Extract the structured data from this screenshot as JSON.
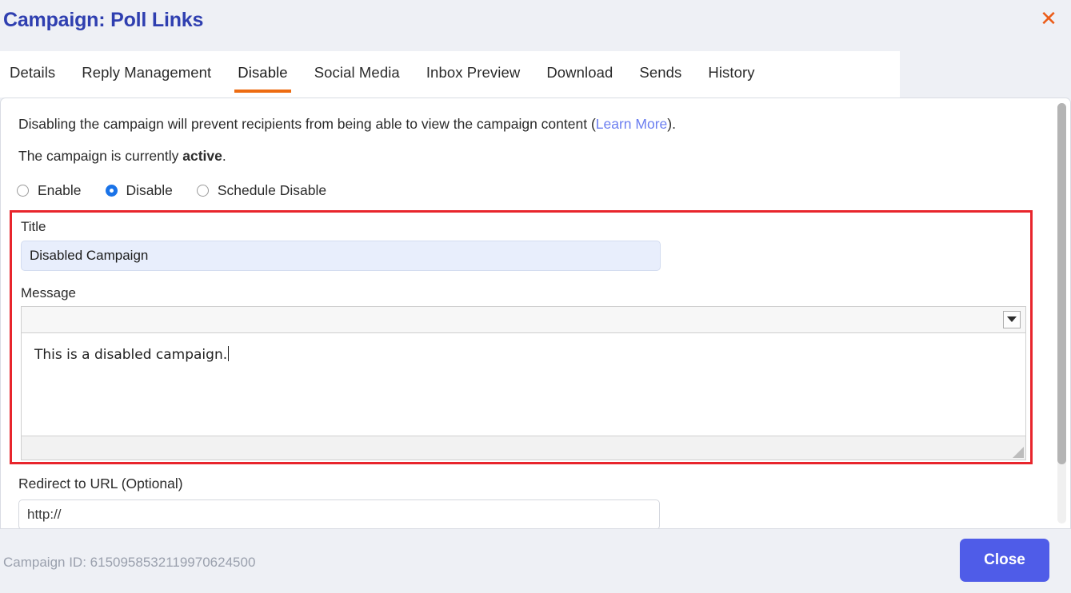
{
  "header": {
    "title": "Campaign: Poll Links",
    "close_icon": "close-x-icon"
  },
  "tabs": [
    {
      "label": "Details",
      "active": false
    },
    {
      "label": "Reply Management",
      "active": false
    },
    {
      "label": "Disable",
      "active": true
    },
    {
      "label": "Social Media",
      "active": false
    },
    {
      "label": "Inbox Preview",
      "active": false
    },
    {
      "label": "Download",
      "active": false
    },
    {
      "label": "Sends",
      "active": false
    },
    {
      "label": "History",
      "active": false
    }
  ],
  "content": {
    "intro_prefix": "Disabling the campaign will prevent recipients from being able to view the campaign content (",
    "intro_link": "Learn More",
    "intro_suffix": ").",
    "status_prefix": "The campaign is currently ",
    "status_value": "active",
    "status_suffix": ".",
    "radios": [
      {
        "label": "Enable",
        "checked": false
      },
      {
        "label": "Disable",
        "checked": true
      },
      {
        "label": "Schedule Disable",
        "checked": false
      }
    ],
    "title_field": {
      "label": "Title",
      "value": "Disabled Campaign",
      "placeholder": ""
    },
    "message_field": {
      "label": "Message",
      "value": "This is a disabled campaign.",
      "toolbar_dropdown_icon": "chevron-down-icon",
      "resize_grip_icon": "resize-grip-icon"
    },
    "redirect_field": {
      "label": "Redirect to URL (Optional)",
      "value": "http://",
      "placeholder": "http://"
    }
  },
  "footer": {
    "campaign_id": "Campaign ID: 6150958532119970624500",
    "close_label": "Close"
  },
  "colors": {
    "title": "#2f3fb0",
    "accent_tab": "#ed6c12",
    "close_x": "#eb5c18",
    "primary_button": "#4f5ce8",
    "highlight_border": "#e8252c",
    "link": "#6b7ef0",
    "radio_checked": "#1a73e8",
    "page_background": "#eef0f5"
  }
}
